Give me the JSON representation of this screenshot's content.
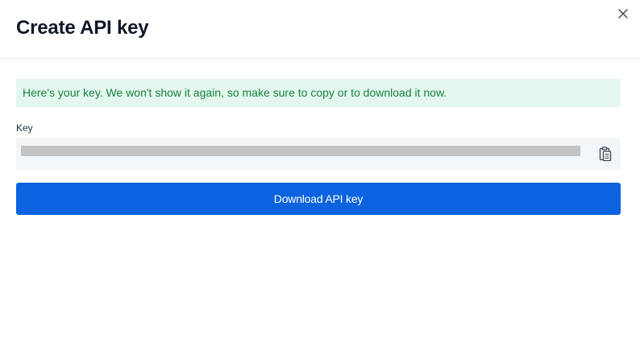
{
  "dialog": {
    "title": "Create API key",
    "close_icon": "close-icon",
    "notice": "Here's your key. We won't show it again, so make sure to copy or to download it now.",
    "key_label": "Key",
    "copy_icon": "clipboard-icon",
    "download_label": "Download API key"
  },
  "colors": {
    "accent": "#0c63df",
    "notice_bg": "#e3f7ee",
    "notice_text": "#17803f",
    "field_bg": "#f3f6f9",
    "masked_key": "#c4c4c4"
  }
}
